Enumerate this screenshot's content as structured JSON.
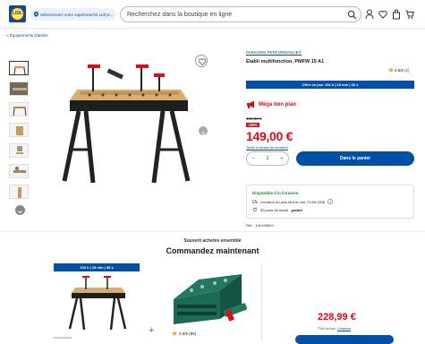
{
  "header": {
    "logo_text": "LIDL",
    "store_selector": "Sélectionnez votre supermarché Lidl pr...",
    "search_placeholder": "Recherchez dans la boutique en ligne"
  },
  "breadcrumb": "< Équipements d'atelier",
  "product": {
    "brand": "PARKSIDE PERFORMANCE®",
    "title": "Établi multifonction, PMFW 15 A1",
    "rating": "4.5/5",
    "rating_count": "(2)",
    "offer_banner": "Offre du jour 154 h | 18 min | 36 s",
    "mega_deal": "Méga bon plan",
    "old_price": "199,00 €",
    "discount": "-25%",
    "price": "149,00 €",
    "tarifs_link": "Tarifs et délais de livraison",
    "quantity": "1",
    "cart_button": "Dans le panier",
    "reference": "Réf. : 100408842"
  },
  "availability": {
    "title": "Disponible à la livraison",
    "delivery": "Livraison au plus tard le mer. 23.09.2026",
    "returns_prefix": "30 jours de retour",
    "returns_bold": "gratuit"
  },
  "bundle": {
    "subtitle": "Souvent achetés ensemble",
    "title": "Commandez maintenant",
    "offer_banner": "154 h | 18 min | 36 s",
    "second_rating": "4.6/5 (89)",
    "bundle_price": "228,99 €",
    "tva_text": "TVA incluse,",
    "tva_link": "Livraison"
  },
  "colors": {
    "lidl_blue": "#0050aa",
    "lidl_red": "#e60a14",
    "lidl_yellow": "#fff04b",
    "availability_green": "#1c8a34"
  }
}
